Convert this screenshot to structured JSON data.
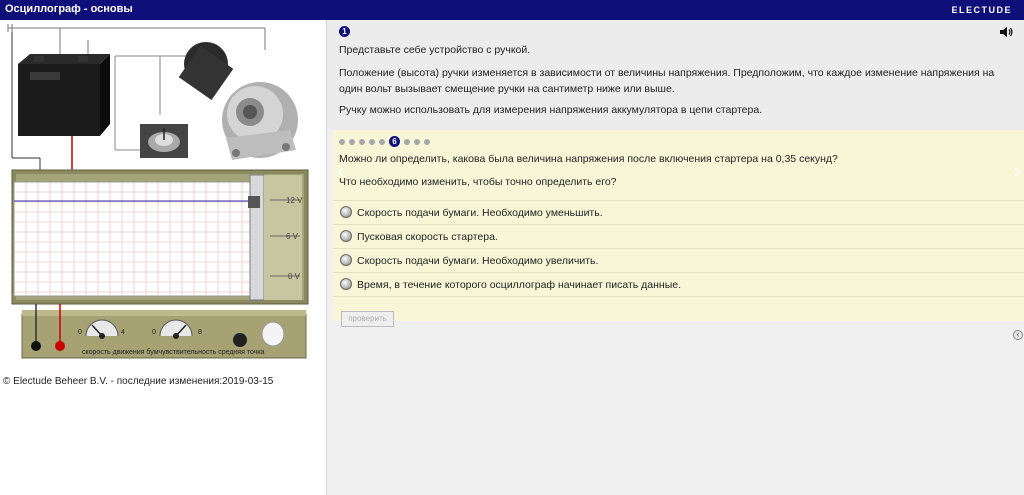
{
  "window": {
    "title": "Осциллограф - основы",
    "brand": "ELECTUDE"
  },
  "diagram": {
    "scale_labels": [
      "12 V",
      "6 V",
      "0 V"
    ],
    "knob_speed": {
      "min": "0",
      "max": "4"
    },
    "knob_sensitivity": {
      "min": "0",
      "max": "8"
    },
    "control_caption": "скорость движения бумчувствительность средняя точка"
  },
  "footer": {
    "copyright": "© Electude Beheer B.V. - последние изменения:2019-03-15"
  },
  "intro": {
    "step": "1",
    "paragraphs": [
      "Представьте себе устройство с ручкой.",
      "Положение (высота) ручки изменяется в зависимости от величины напряжения. Предположим, что каждое изменение напряжения на один вольт вызывает смещение ручки на сантиметр ниже или выше.",
      "Ручку можно использовать для измерения напряжения аккумулятора в цепи стартера."
    ]
  },
  "quiz": {
    "progress": {
      "current": "6",
      "total": 9
    },
    "question": "Можно ли определить, какова была величина напряжения после включения стартера на 0,35 секунд?",
    "sub_question": "Что необходимо изменить, чтобы точно определить его?",
    "answers": [
      "Скорость подачи бумаги. Необходимо уменьшить.",
      "Пусковая скорость стартера.",
      "Скорость подачи бумаги. Необходимо увеличить.",
      "Время, в течение которого осциллограф начинает писать данные."
    ],
    "check_label": "проверить"
  },
  "colors": {
    "titlebar": "#0f0f7a",
    "quiz_bg": "#f7f7d8",
    "panel_bg": "#ececec",
    "recorder_frame": "#8a8a60"
  }
}
